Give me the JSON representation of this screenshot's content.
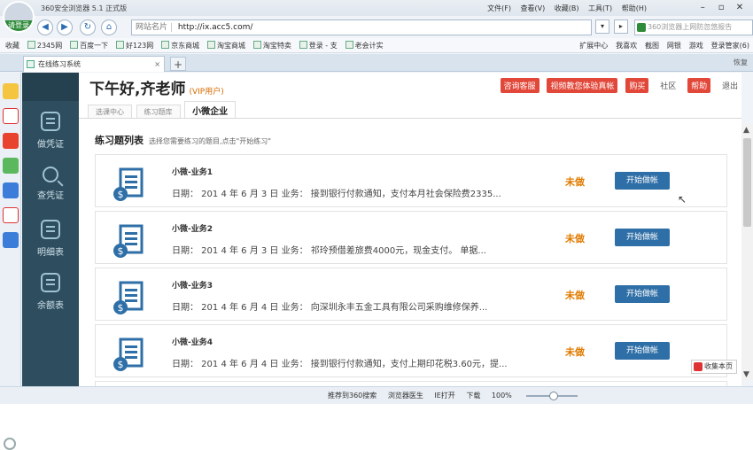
{
  "browser": {
    "title": "360安全浏览器 5.1 正式版",
    "login_label": "请登录",
    "menus": [
      "文件(F)",
      "查看(V)",
      "收藏(B)",
      "工具(T)",
      "帮助(H)"
    ],
    "url_tag": "网站名片",
    "url": "http://ix.acc5.com/",
    "url_domain": "acc5.com",
    "search_placeholder": "360浏览器上网防忽悠报告",
    "search_button": "搜",
    "favorites": [
      "收藏",
      "2345网",
      "百度一下",
      "好123网",
      "京东商城",
      "淘宝商城",
      "淘宝特卖",
      "登录 - 支",
      "老会计实"
    ],
    "fav_right": [
      "扩展中心",
      "我喜欢",
      "截图",
      "网银",
      "游戏",
      "登录管家(6)"
    ],
    "tab_label": "在线练习系统",
    "tab_right": "恢复",
    "collect_label": "收集本页",
    "status_items": [
      "推荐到360搜索",
      "浏览器医生",
      "IE打开",
      "下载",
      "100%"
    ]
  },
  "sidebar": {
    "items": [
      {
        "label": "做凭证",
        "icon": "document-icon"
      },
      {
        "label": "查凭证",
        "icon": "magnifier-icon"
      },
      {
        "label": "明细表",
        "icon": "list-icon"
      },
      {
        "label": "余额表",
        "icon": "list-icon"
      }
    ]
  },
  "header": {
    "greeting": "下午好,齐老师",
    "vip": "(VIP用户)",
    "buttons": [
      "咨询客服",
      "视频教您体验真帐",
      "购买",
      "社区",
      "帮助",
      "退出"
    ],
    "tabs": [
      "选课中心",
      "练习题库",
      "小微企业"
    ]
  },
  "list": {
    "title": "练习题列表",
    "hint": "选择您需要练习的题目,点击\"开始练习\"",
    "items": [
      {
        "title": "小微-业务1",
        "desc": "日期： 201 4 年 6 月 3 日 业务： 接到银行付款通知，支付本月社会保险费2335...",
        "status": "未做",
        "button": "开始做帐"
      },
      {
        "title": "小微-业务2",
        "desc": "日期： 201 4 年 6 月 3 日 业务： 祁玲预借差旅费4000元，现金支付。 单据...",
        "status": "未做",
        "button": "开始做帐"
      },
      {
        "title": "小微-业务3",
        "desc": "日期： 201 4 年 6 月 4 日 业务： 向深圳永丰五金工具有限公司采购维修保养...",
        "status": "未做",
        "button": "开始做帐"
      },
      {
        "title": "小微-业务4",
        "desc": "日期： 201 4 年 6 月 4 日 业务： 接到银行付款通知，支付上期印花税3.60元，提...",
        "status": "未做",
        "button": "开始做帐"
      }
    ]
  }
}
